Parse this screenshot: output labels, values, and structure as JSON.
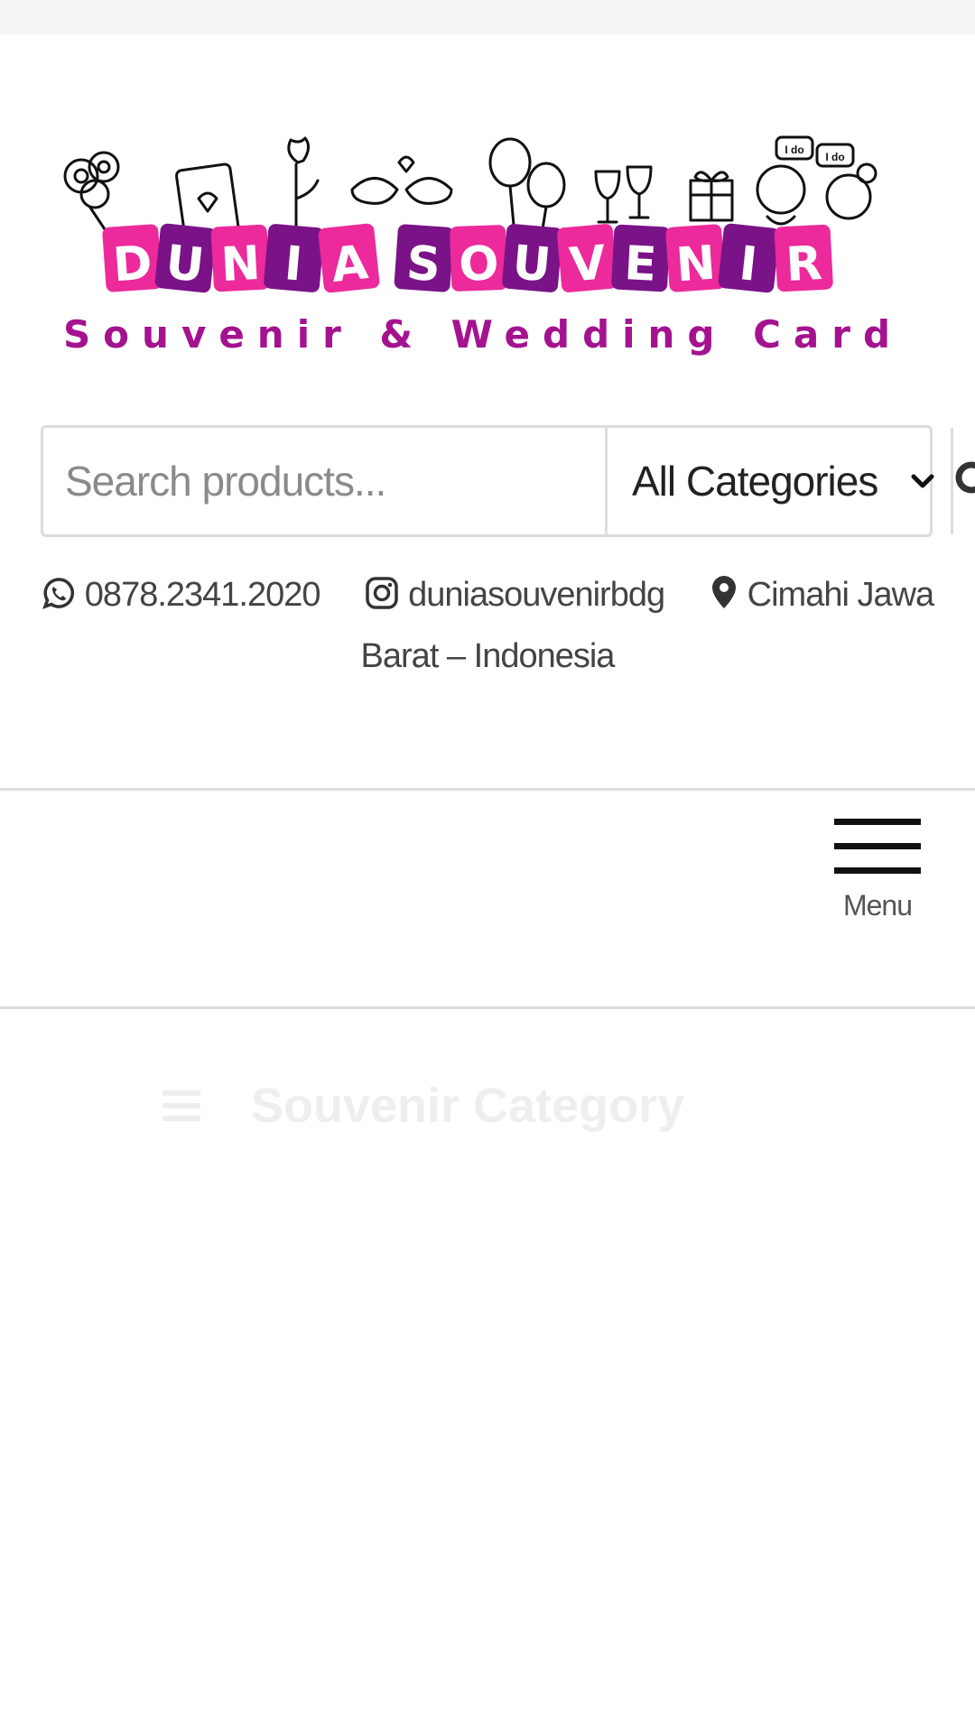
{
  "brand": {
    "name_part1": "DUNIA",
    "name_part2": "SOUVENIR",
    "tagline": "Souvenir & Wedding Card",
    "speech1": "I do",
    "speech2": "I do",
    "colors": {
      "pink": "#ec2a9c",
      "purple": "#7a1387",
      "tagline": "#a4128f"
    }
  },
  "search": {
    "placeholder": "Search products...",
    "category_selected": "All Categories",
    "button_icon": "search-icon"
  },
  "contacts": {
    "phone": "0878.2341.2020",
    "instagram": "duniasouvenirbdg",
    "location_part1": "Cimahi Jawa Barat –",
    "location_part2": "Indonesia"
  },
  "menu": {
    "label": "Menu"
  },
  "category_header": {
    "title": "Souvenir Category"
  }
}
